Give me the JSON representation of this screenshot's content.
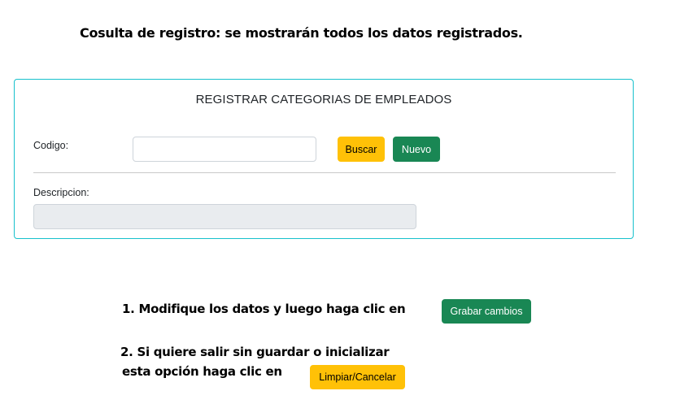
{
  "heading": "Cosulta de registro: se mostrarán todos los datos registrados.",
  "form": {
    "title": "REGISTRAR CATEGORIAS DE EMPLEADOS",
    "codigo_label": "Codigo:",
    "codigo_value": "",
    "buscar_label": "Buscar",
    "nuevo_label": "Nuevo",
    "descripcion_label": "Descripcion:",
    "descripcion_value": ""
  },
  "instructions": {
    "step1_text": "1. Modifique  los datos y luego haga clic en",
    "step1_button": "Grabar cambios",
    "step2_line1": "2.  Si quiere salir sin guardar o inicializar",
    "step2_line2": "esta opción haga clic en",
    "step2_button": "Limpiar/Cancelar"
  },
  "colors": {
    "card_border": "#17c1cc",
    "warning": "#ffc107",
    "success": "#198754",
    "disabled_input": "#e9ecef"
  }
}
